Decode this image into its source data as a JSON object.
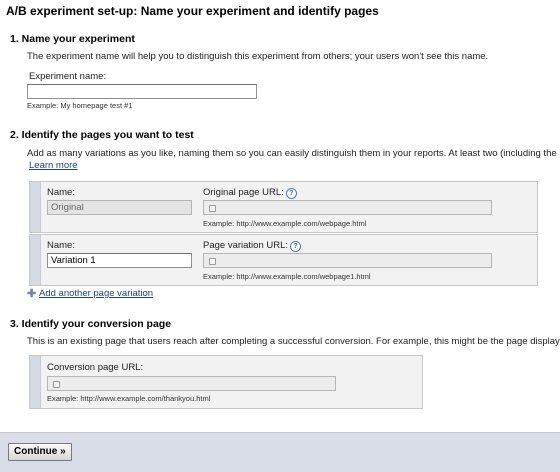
{
  "page_title": "A/B experiment set-up: Name your experiment and identify pages",
  "section1": {
    "heading": "1. Name your experiment",
    "description": "The experiment name will help you to distinguish this experiment from others; your users won't see this name.",
    "name_label": "Experiment name:",
    "name_value": "",
    "example": "Example: My homepage test #1"
  },
  "section2": {
    "heading": "2. Identify the pages you want to test",
    "description": "Add as many variations as you like, naming them so you can easily distinguish them in your reports. At least two (including the",
    "learn_more": "Learn more",
    "original": {
      "name_label": "Name:",
      "name_value": "Original",
      "url_label": "Original page URL:",
      "help_glyph": "?",
      "example": "Example: http://www.example.com/webpage.html"
    },
    "variation": {
      "name_label": "Name:",
      "name_value": "Variation 1",
      "url_label": "Page variation URL:",
      "help_glyph": "?",
      "example": "Example: http://www.example.com/webpage1.html"
    },
    "add_variation": "Add another page variation",
    "add_glyph": "✚"
  },
  "section3": {
    "heading": "3. Identify your conversion page",
    "description": "This is an existing page that users reach after completing a successful conversion. For example, this might be the page display",
    "url_label": "Conversion page URL:",
    "example": "Example: http://www.example.com/thankyou.html"
  },
  "footer": {
    "continue_label": "Continue »"
  },
  "icons": {
    "help": "help-icon",
    "url": "url-lock-icon",
    "add": "plus-icon"
  }
}
